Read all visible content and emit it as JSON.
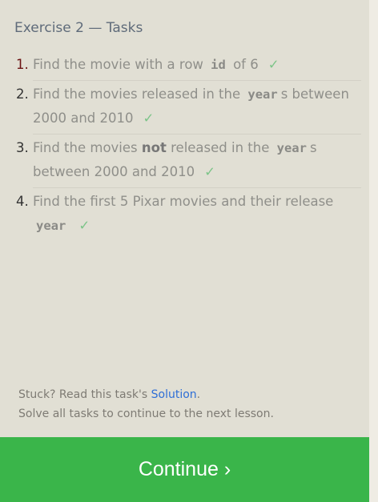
{
  "title": "Exercise 2 — Tasks",
  "tasks": [
    {
      "num": "1.",
      "pre": "Find the movie with a row",
      "code": "id",
      "mid": "of 6",
      "check": "✓"
    },
    {
      "num": "2.",
      "pre": "Find the movies released in the",
      "code": "year",
      "post": "s between 2000 and 2010",
      "check": "✓"
    },
    {
      "num": "3.",
      "pre": "Find the movies",
      "bold": "not",
      "pre2": "released in the",
      "code": "year",
      "post": "s between 2000 and 2010",
      "check": "✓"
    },
    {
      "num": "4.",
      "pre": "Find the first 5 Pixar movies and their release",
      "code": "year",
      "check": "✓"
    }
  ],
  "footer": {
    "stuck_prefix": "Stuck? Read this task's ",
    "solution_link": "Solution",
    "stuck_suffix": ".",
    "hint": "Solve all tasks to continue to the next lesson."
  },
  "continue_label": "Continue ›",
  "colors": {
    "accent": "#3ab54a",
    "link": "#2f6fd6",
    "check": "#7cc488"
  }
}
